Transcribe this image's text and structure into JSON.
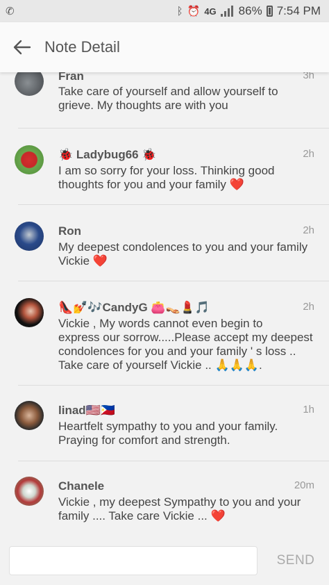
{
  "status_bar": {
    "network": "4G",
    "battery": "86%",
    "time": "7:54 PM"
  },
  "app_bar": {
    "title": "Note Detail",
    "back_icon": "arrow-left-icon"
  },
  "comments": [
    {
      "name": "Fran",
      "time": "3h",
      "text": "Take care of yourself and allow yourself to grieve. My thoughts are with you"
    },
    {
      "name": "🐞 Ladybug66 🐞",
      "time": "2h",
      "text": "I am so sorry for your loss. Thinking good thoughts for you and your family ❤️"
    },
    {
      "name": "Ron",
      "time": "2h",
      "text": "My deepest condolences to you and your family Vickie ❤️"
    },
    {
      "name": "👠💅🎶CandyG 👛👡💄🎵",
      "time": "2h",
      "text": "Vickie , My words cannot  even begin to\n express our sorrow.....Please accept  my deepest condolences for you and your family ' s loss .. Take care of yourself Vickie .. 🙏🙏🙏."
    },
    {
      "name": "linad🇺🇸🇵🇭",
      "time": "1h",
      "text": "Heartfelt sympathy to you and your family. Praying for comfort and strength."
    },
    {
      "name": "Chanele",
      "time": "20m",
      "text": "Vickie , my deepest Sympathy to you and your family .... Take care Vickie ... ❤️"
    }
  ],
  "composer": {
    "placeholder": "",
    "send_label": "SEND"
  }
}
